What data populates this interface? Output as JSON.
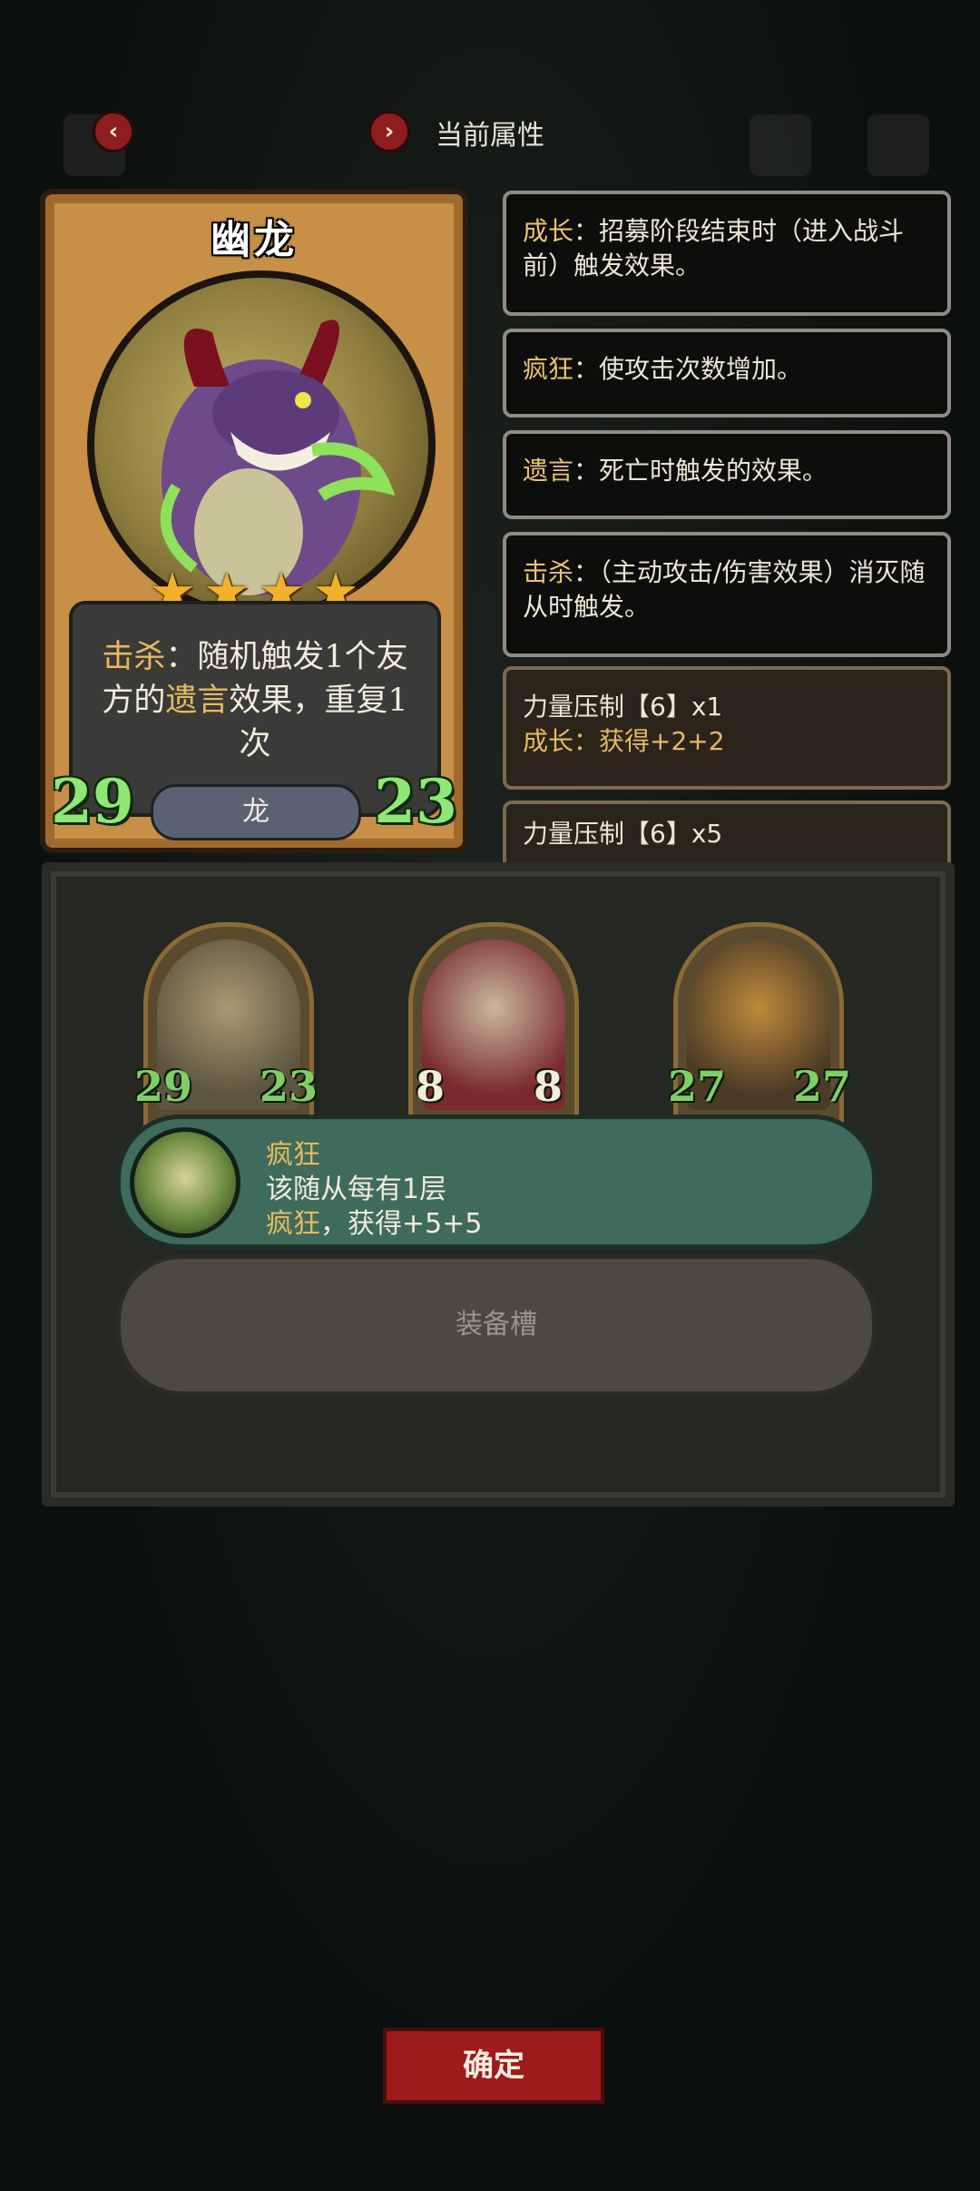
{
  "header": {
    "title": "当前属性",
    "prev_icon": "chevron-left-icon",
    "next_icon": "chevron-right-icon"
  },
  "card": {
    "name": "幽龙",
    "stars": 4,
    "description_kw1": "击杀",
    "description_part1": "：随机触发1个友方的",
    "description_kw2": "遗言",
    "description_part2": "效果，重复1次",
    "type": "龙",
    "attack": "29",
    "health": "23"
  },
  "keywords": [
    {
      "key": "成长",
      "text": "：招募阶段结束时（进入战斗前）触发效果。"
    },
    {
      "key": "疯狂",
      "text": "：使攻击次数增加。"
    },
    {
      "key": "遗言",
      "text": "：死亡时触发的效果。"
    },
    {
      "key": "击杀",
      "text": "：（主动攻击/伤害效果）消灭随从时触发。"
    }
  ],
  "buffs": [
    {
      "title": "力量压制【6】x1",
      "key": "成长",
      "text": "：获得+2+2"
    },
    {
      "title": "力量压制【6】x5"
    }
  ],
  "minions": [
    {
      "attack": "29",
      "health": "23"
    },
    {
      "attack": "8",
      "health": "8"
    },
    {
      "attack": "27",
      "health": "27"
    }
  ],
  "tooltip": {
    "title": "疯狂",
    "line1": "该随从每有1层",
    "line2_key": "疯狂",
    "line2_text": "，获得+5+5"
  },
  "equip_slot": "装备槽",
  "confirm_label": "确定"
}
